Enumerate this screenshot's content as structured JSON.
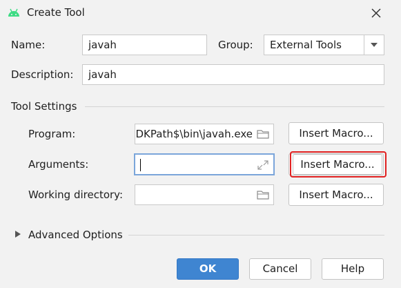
{
  "window": {
    "title": "Create Tool",
    "icon": "android-icon",
    "close_icon": "close-icon"
  },
  "form": {
    "name_label": "Name:",
    "name_value": "javah",
    "group_label": "Group:",
    "group_value": "External Tools",
    "description_label": "Description:",
    "description_value": "javah"
  },
  "tool_settings": {
    "section_title": "Tool Settings",
    "program_label": "Program:",
    "program_value": "DKPath$\\bin\\javah.exe",
    "arguments_label": "Arguments:",
    "arguments_value": "",
    "working_dir_label": "Working directory:",
    "working_dir_value": "",
    "insert_macro_label": "Insert Macro..."
  },
  "advanced": {
    "label": "Advanced Options"
  },
  "footer": {
    "ok_label": "OK",
    "cancel_label": "Cancel",
    "help_label": "Help"
  },
  "colors": {
    "primary_button": "#3f85d1",
    "highlight_box": "#e02020",
    "focus_border": "#7aa5da",
    "android_green": "#3ddc84"
  }
}
